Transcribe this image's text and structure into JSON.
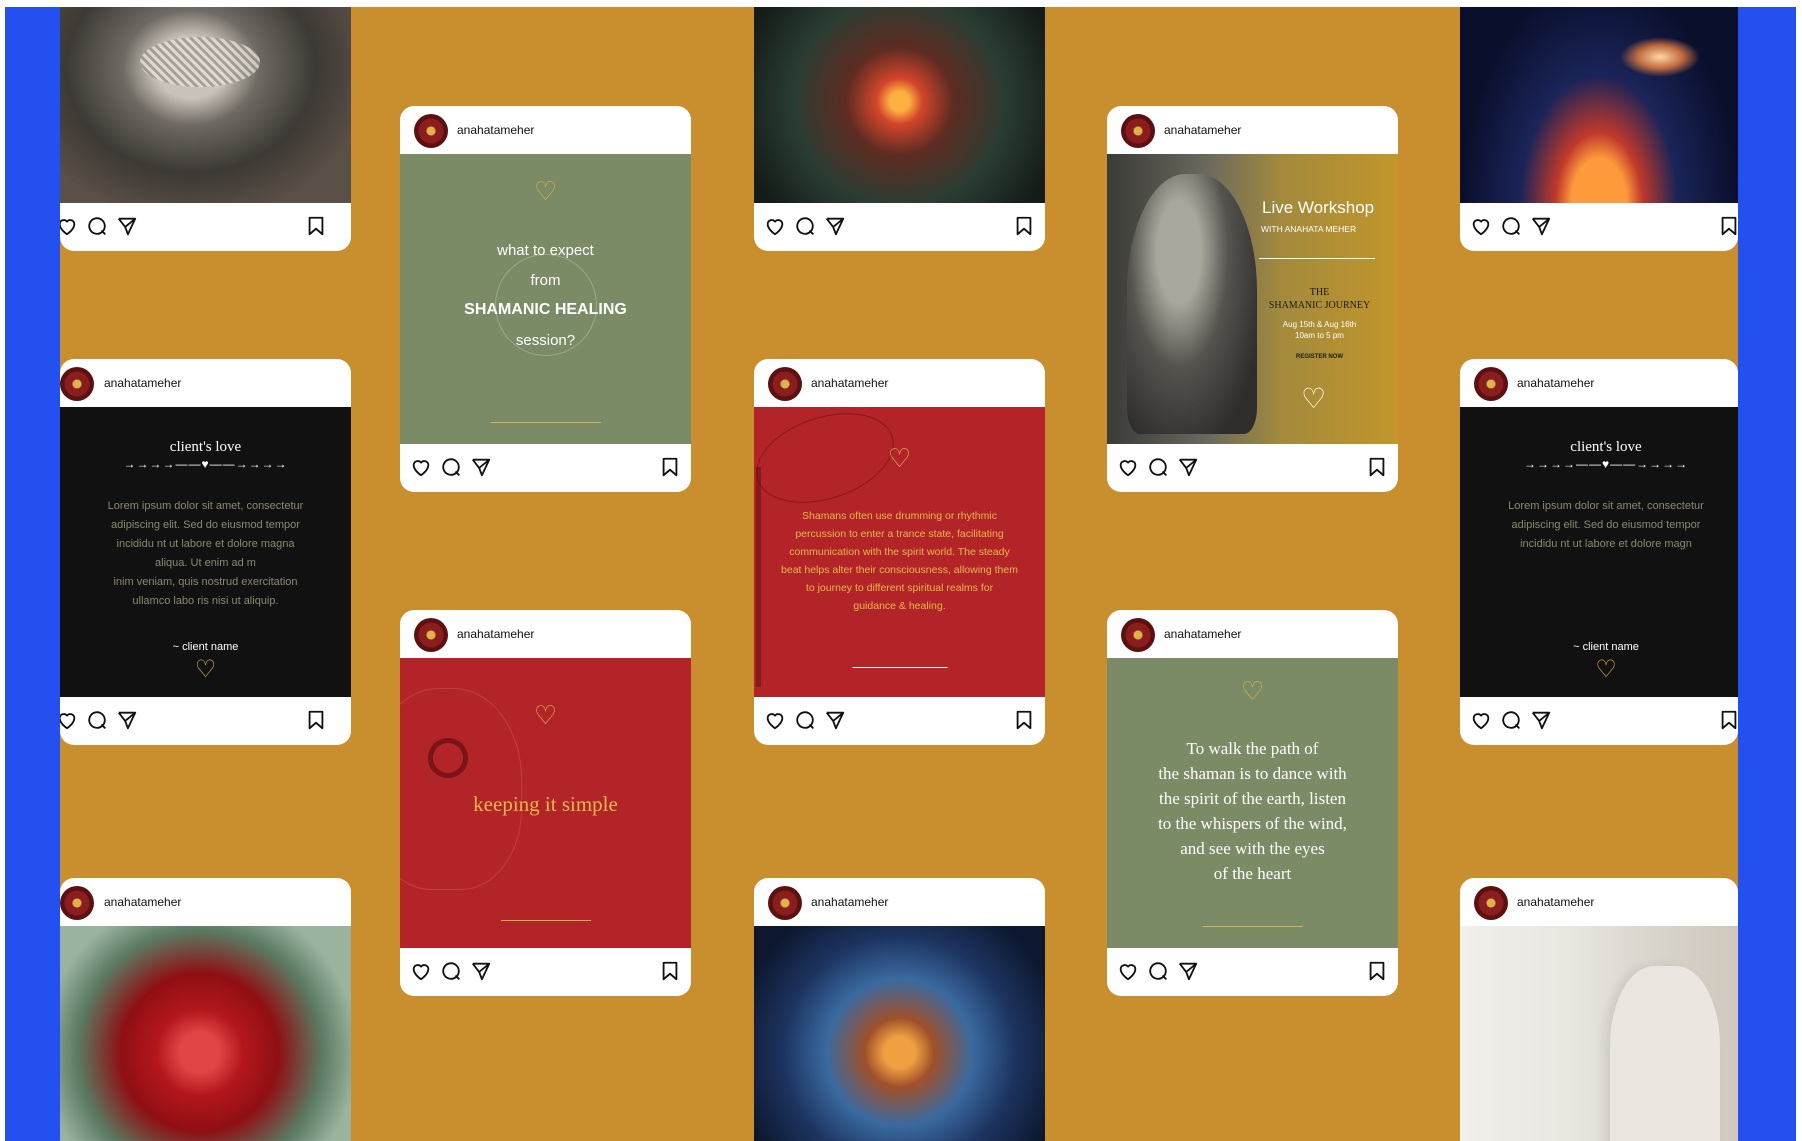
{
  "handle": "anahatameher",
  "colors": {
    "frame": "#2450f0",
    "board": "#c98f2e",
    "sage": "#7a8b65",
    "red": "#b32428",
    "black": "#111111",
    "gold": "#d8b04c"
  },
  "posts": {
    "shamanic_healing": {
      "line1": "what to expect",
      "line2": "from",
      "line3": "SHAMANIC HEALING",
      "line4": "session?"
    },
    "workshop": {
      "title": "Live Workshop",
      "subtitle": "WITH ANAHATA MEHER",
      "event_line1": "THE",
      "event_line2": "SHAMANIC JOURNEY",
      "dates": "Aug 15th & Aug 16th",
      "time": "10am to 5 pm",
      "cta": "REGISTER NOW"
    },
    "client_love_1": {
      "title": "client's love",
      "body": [
        "Lorem ipsum dolor sit amet, consectetur",
        "adipiscing elit. Sed do eiusmod tempor",
        "incididu nt ut labore et dolore magna",
        "aliqua. Ut enim ad m",
        "inim veniam, quis nostrud exercitation",
        "ullamco labo ris nisi ut aliquip."
      ],
      "signature": "~ client name"
    },
    "client_love_2": {
      "title": "client's love",
      "body": [
        "Lorem ipsum dolor sit amet, consectetur",
        "adipiscing elit. Sed do eiusmod tempor",
        "incididu nt ut labore et dolore magn"
      ],
      "signature": "~ client name"
    },
    "drumming": {
      "body": [
        "Shamans often use drumming or rhythmic",
        "percussion to enter a trance state, facilitating",
        "communication with the spirit world. The steady",
        "beat helps alter their consciousness, allowing them",
        "to journey to different spiritual realms for",
        "guidance & healing."
      ]
    },
    "keeping_simple": {
      "text": "keeping it simple"
    },
    "quote": {
      "lines": [
        "To walk the path of",
        "the shaman is to dance with",
        "the spirit of the earth, listen",
        "to the whispers of the wind,",
        "and see with the eyes",
        "of the heart"
      ]
    }
  },
  "icons": [
    "heart-icon",
    "comment-icon",
    "share-icon",
    "bookmark-icon"
  ]
}
